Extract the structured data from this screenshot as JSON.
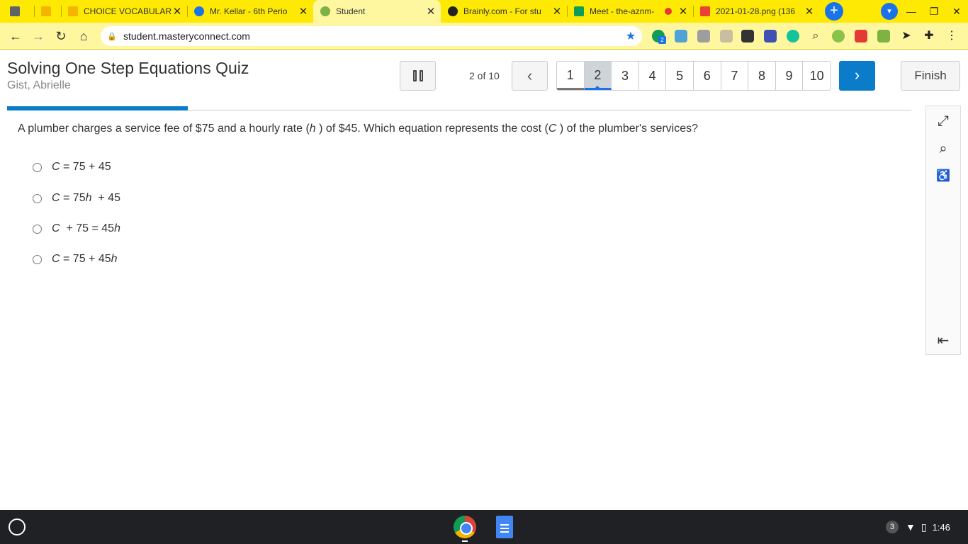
{
  "browser": {
    "tabs": [
      {
        "title": "",
        "favicon_color": "#5f6368"
      },
      {
        "title": "",
        "favicon_color": "#f4b400"
      },
      {
        "title": "CHOICE VOCABULAR",
        "favicon_color": "#f4b400"
      },
      {
        "title": "Mr. Kellar - 6th Perio",
        "favicon_color": "#1a73e8"
      },
      {
        "title": "Student",
        "favicon_color": "#7cb342"
      },
      {
        "title": "Brainly.com - For stu",
        "favicon_color": "#222222"
      },
      {
        "title": "Meet - the-aznm-",
        "favicon_color": "#0f9d58"
      },
      {
        "title": "2021-01-28.png (136",
        "favicon_color": "#ea4335"
      }
    ],
    "close_glyph": "✕",
    "new_tab_glyph": "+",
    "url": "student.masteryconnect.com",
    "extension_badge": "2"
  },
  "quiz": {
    "title": "Solving One Step Equations Quiz",
    "student": "Gist, Abrielle",
    "progress_text": "2 of 10",
    "progress_fraction": 0.2,
    "questions": [
      "1",
      "2",
      "3",
      "4",
      "5",
      "6",
      "7",
      "8",
      "9",
      "10"
    ],
    "current_question": "2",
    "finish_label": "Finish",
    "question": {
      "part1": "A plumber charges a service fee of $75 and a hourly rate (",
      "var1": "h",
      "part2": " ) of $45. Which equation represents the cost (",
      "var2": "C",
      "part3": " ) of the plumber's services?"
    },
    "choices": [
      {
        "a": "C",
        "b": " = 75 + 45",
        "c": "",
        "d": ""
      },
      {
        "a": "C",
        "b": " = 75",
        "c": "h",
        "d": "  + 45"
      },
      {
        "a": "C",
        "b": "  + 75 = 45",
        "c": "h",
        "d": ""
      },
      {
        "a": "C",
        "b": " = 75 + 45",
        "c": "h",
        "d": ""
      }
    ]
  },
  "tools": {
    "expand_icon": "⤢",
    "magnifier_icon": "⌕",
    "accessibility_icon": "♿",
    "collapse_icon": "⇤"
  },
  "taskbar": {
    "notification_count": "3",
    "time": "1:46"
  }
}
